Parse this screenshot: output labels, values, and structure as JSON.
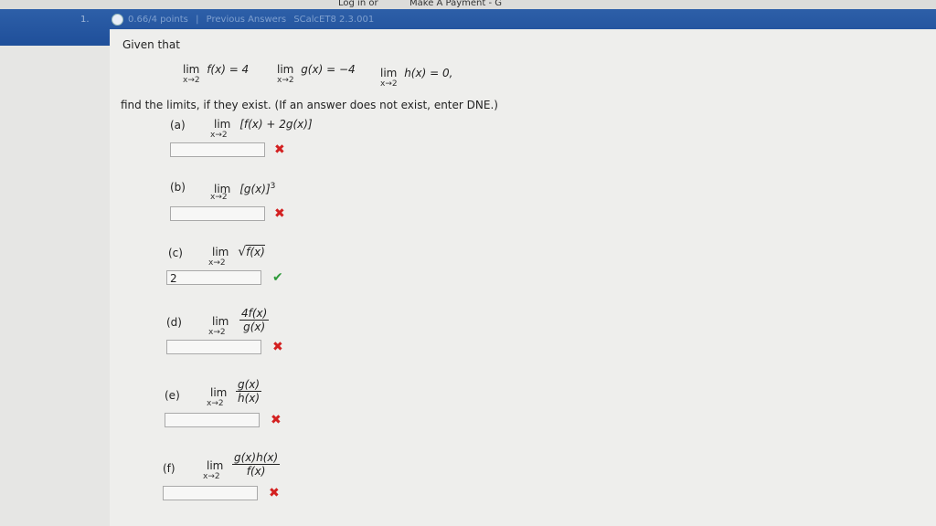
{
  "browser": {
    "tab_left": "Log in or",
    "tab_right": "Make A Payment - G"
  },
  "header": {
    "question_number": "1.",
    "points": "0.66/4 points",
    "separator": "|",
    "previous_answers": "Previous Answers",
    "problem_code": "SCalcET8 2.3.001"
  },
  "intro": {
    "given": "Given that",
    "conditions": [
      {
        "lim": "lim",
        "sub": "x→2",
        "expr": "f(x) = 4"
      },
      {
        "lim": "lim",
        "sub": "x→2",
        "expr": "g(x) = −4"
      },
      {
        "lim": "lim",
        "sub": "x→2",
        "expr": "h(x) = 0,"
      }
    ],
    "instruction": "find the limits, if they exist. (If an answer does not exist, enter DNE.)"
  },
  "parts": [
    {
      "label": "(a)",
      "lim": "lim",
      "sub": "x→2",
      "expr": "[f(x) + 2g(x)]",
      "answer": "",
      "status": "incorrect",
      "mark": "✖"
    },
    {
      "label": "(b)",
      "lim": "lim",
      "sub": "x→2",
      "expr": "[g(x)]",
      "sup": "3",
      "answer": "",
      "status": "incorrect",
      "mark": "✖"
    },
    {
      "label": "(c)",
      "lim": "lim",
      "sub": "x→2",
      "sqrt": "√",
      "expr": "f(x)",
      "answer": "2",
      "status": "correct",
      "mark": "✔"
    },
    {
      "label": "(d)",
      "lim": "lim",
      "sub": "x→2",
      "num": "4f(x)",
      "den": "g(x)",
      "answer": "",
      "status": "incorrect",
      "mark": "✖"
    },
    {
      "label": "(e)",
      "lim": "lim",
      "sub": "x→2",
      "num": "g(x)",
      "den": "h(x)",
      "answer": "",
      "status": "incorrect",
      "mark": "✖"
    },
    {
      "label": "(f)",
      "lim": "lim",
      "sub": "x→2",
      "num": "g(x)h(x)",
      "den": "f(x)",
      "answer": "",
      "status": "incorrect",
      "mark": "✖"
    }
  ],
  "colors": {
    "header": "#1f4f9a",
    "incorrect": "#d32020",
    "correct": "#2e9a3a"
  }
}
